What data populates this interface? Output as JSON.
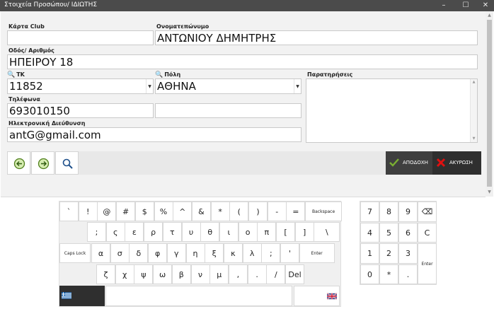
{
  "window": {
    "title": "Στοιχεία Προσώπου/ ΙΔΙΩΤΗΣ",
    "minimize": "–",
    "maximize": "☐",
    "close": "✕"
  },
  "form": {
    "club_card_label": "Κάρτα Club",
    "club_card_value": "",
    "name_label": "Ονοματεπώνυμο",
    "name_value": "ΑΝΤΩΝΙΟΥ ΔΗΜΗΤΡΗΣ",
    "address_label": "Οδός/ Αριθμός",
    "address_value": "ΗΠΕΙΡΟΥ 18",
    "zip_label": "ΤΚ",
    "zip_value": "11852",
    "city_label": "Πόλη",
    "city_value": "ΑΘΗΝΑ",
    "notes_label": "Παρατηρήσεις",
    "notes_value": "",
    "phones_label": "Τηλέφωνα",
    "phone1_value": "693010150",
    "phone2_value": "",
    "email_label": "Ηλεκτρονική Διεύθυνση",
    "email_value": "antG@gmail.com"
  },
  "toolbar": {
    "back_icon": "arrow-left-circle",
    "forward_icon": "arrow-right-circle",
    "search_icon": "magnifier",
    "accept_label": "ΑΠΟΔΟΧΗ",
    "cancel_label": "ΑΚΥΡΩΣΗ",
    "accept_color": "#6a9a2b",
    "cancel_color": "#e01010"
  },
  "keyboard": {
    "rows": [
      [
        "`",
        "!",
        "@",
        "#",
        "$",
        "%",
        "^",
        "&",
        "*",
        "(",
        ")",
        "-",
        "=",
        "Backspace"
      ],
      [
        ";",
        "ς",
        "ε",
        "ρ",
        "τ",
        "υ",
        "θ",
        "ι",
        "ο",
        "π",
        "[",
        "]",
        "\\"
      ],
      [
        "Caps Lock",
        "α",
        "σ",
        "δ",
        "φ",
        "γ",
        "η",
        "ξ",
        "κ",
        "λ",
        ";",
        "'",
        "Enter"
      ],
      [
        "ζ",
        "χ",
        "ψ",
        "ω",
        "β",
        "ν",
        "μ",
        ",",
        ".",
        "/",
        "Del"
      ]
    ],
    "numpad": [
      [
        "7",
        "8",
        "9",
        "⌫"
      ],
      [
        "4",
        "5",
        "6",
        "C"
      ],
      [
        "1",
        "2",
        "3",
        "Enter"
      ],
      [
        "0",
        "*",
        "."
      ]
    ],
    "lang_left": "greek-flag",
    "lang_right": "uk-flag"
  }
}
